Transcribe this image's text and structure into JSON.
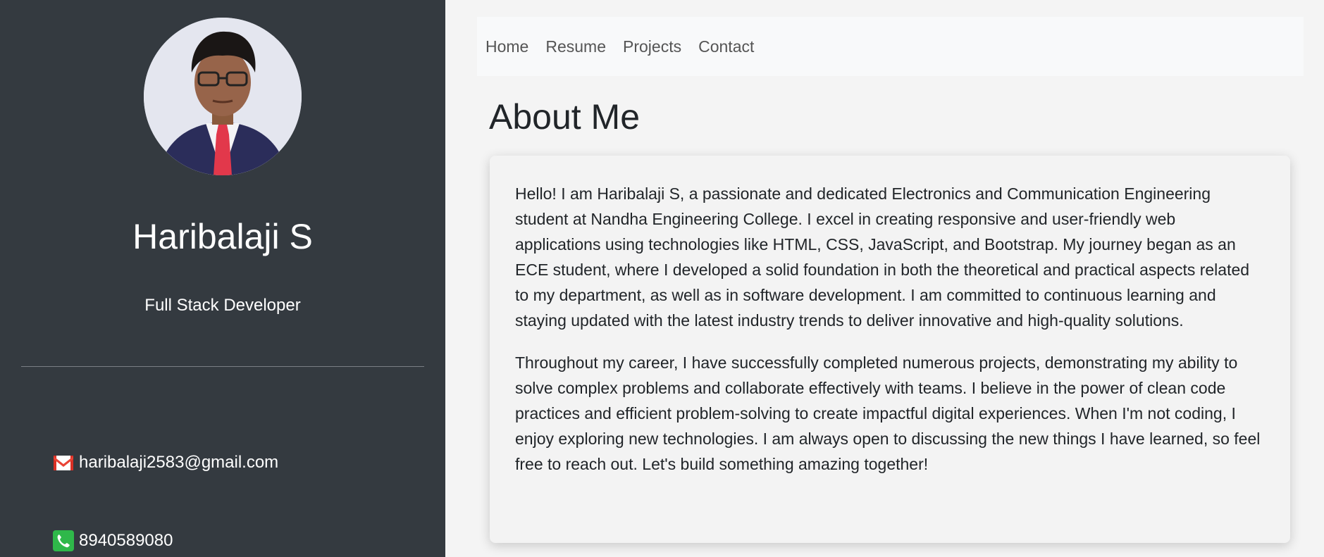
{
  "profile": {
    "name": "Haribalaji S",
    "role": "Full Stack Developer",
    "avatar_alt": "profile photo"
  },
  "contact": {
    "email": "haribalaji2583@gmail.com",
    "email_icon": "gmail-icon",
    "phone": "8940589080",
    "phone_icon": "phone-icon"
  },
  "nav": {
    "items": [
      {
        "label": "Home"
      },
      {
        "label": "Resume"
      },
      {
        "label": "Projects"
      },
      {
        "label": "Contact"
      }
    ]
  },
  "about": {
    "title": "About Me",
    "paragraphs": [
      "Hello! I am Haribalaji S, a passionate and dedicated Electronics and Communication Engineering student at Nandha Engineering College. I excel in creating responsive and user-friendly web applications using technologies like HTML, CSS, JavaScript, and Bootstrap. My journey began as an ECE student, where I developed a solid foundation in both the theoretical and practical aspects related to my department, as well as in software development. I am committed to continuous learning and staying updated with the latest industry trends to deliver innovative and high-quality solutions.",
      "Throughout my career, I have successfully completed numerous projects, demonstrating my ability to solve complex problems and collaborate effectively with teams. I believe in the power of clean code practices and efficient problem-solving to create impactful digital experiences. When I'm not coding, I enjoy exploring new technologies. I am always open to discussing the new things I have learned, so feel free to reach out. Let's build something amazing together!"
    ]
  },
  "colors": {
    "sidebar_bg": "#343a40",
    "page_bg": "#f4f4f4",
    "navbar_bg": "#f8f9fa",
    "text_dark": "#212529",
    "nav_text": "#555555"
  }
}
